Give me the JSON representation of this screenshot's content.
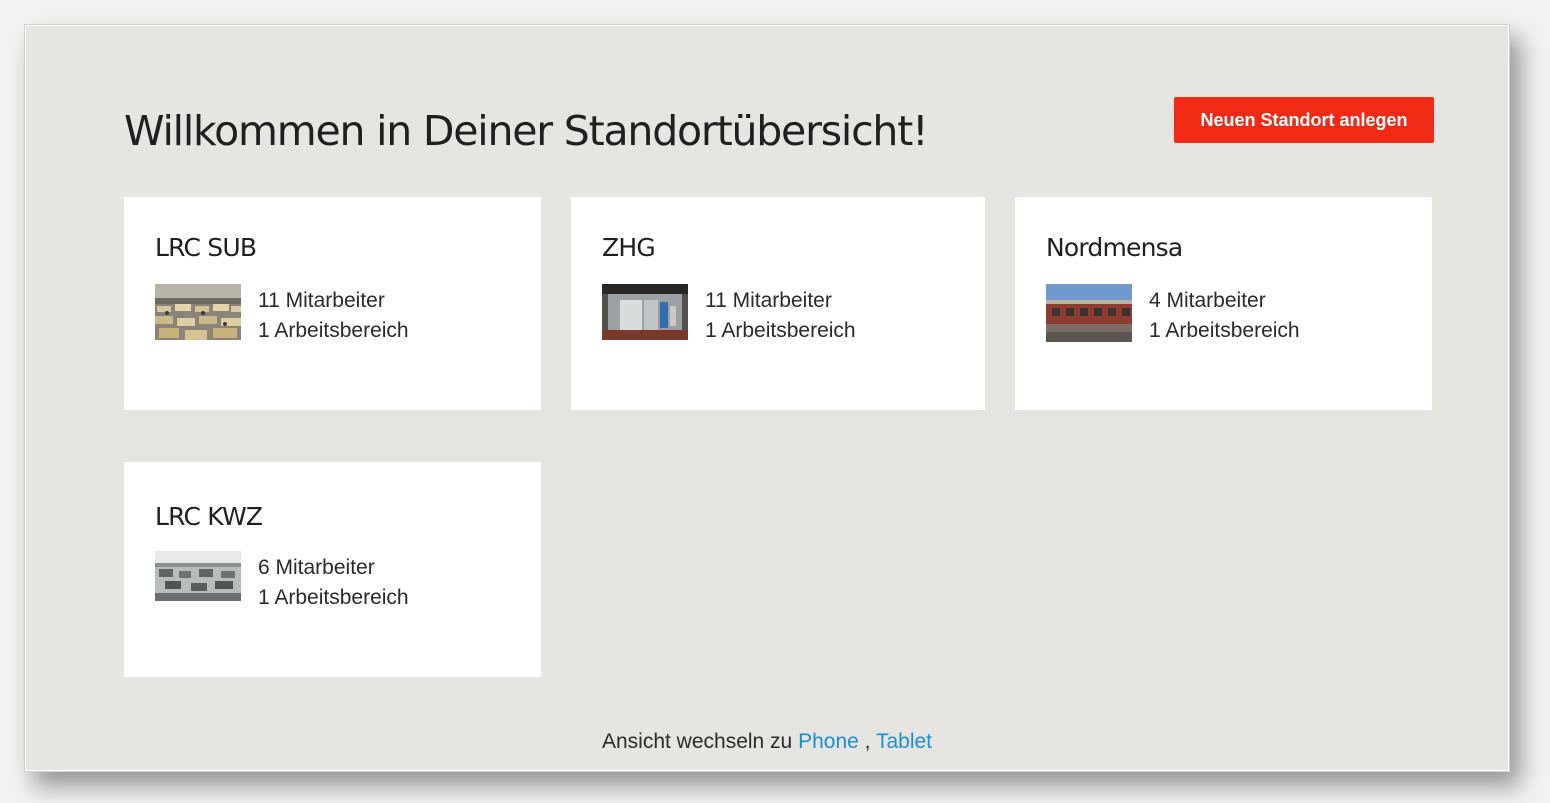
{
  "header": {
    "title": "Willkommen in Deiner Standortübersicht!",
    "new_location_label": "Neuen Standort anlegen"
  },
  "locations": [
    {
      "name": "LRC SUB",
      "employees": "11 Mitarbeiter",
      "areas": "1 Arbeitsbereich",
      "image": "library-room-photo"
    },
    {
      "name": "ZHG",
      "employees": "11 Mitarbeiter",
      "areas": "1 Arbeitsbereich",
      "image": "building-entrance-photo"
    },
    {
      "name": "Nordmensa",
      "employees": "4 Mitarbeiter",
      "areas": "1 Arbeitsbereich",
      "image": "brick-building-photo"
    },
    {
      "name": "LRC KWZ",
      "employees": "6 Mitarbeiter",
      "areas": "1 Arbeitsbereich",
      "image": "study-room-photo"
    }
  ],
  "footer": {
    "prefix": "Ansicht wechseln zu",
    "phone_link": "Phone",
    "separator": ",",
    "tablet_link": "Tablet"
  },
  "colors": {
    "accent_button": "#f12a16",
    "link": "#1a8fd0",
    "page_background": "#e6e5e2"
  }
}
